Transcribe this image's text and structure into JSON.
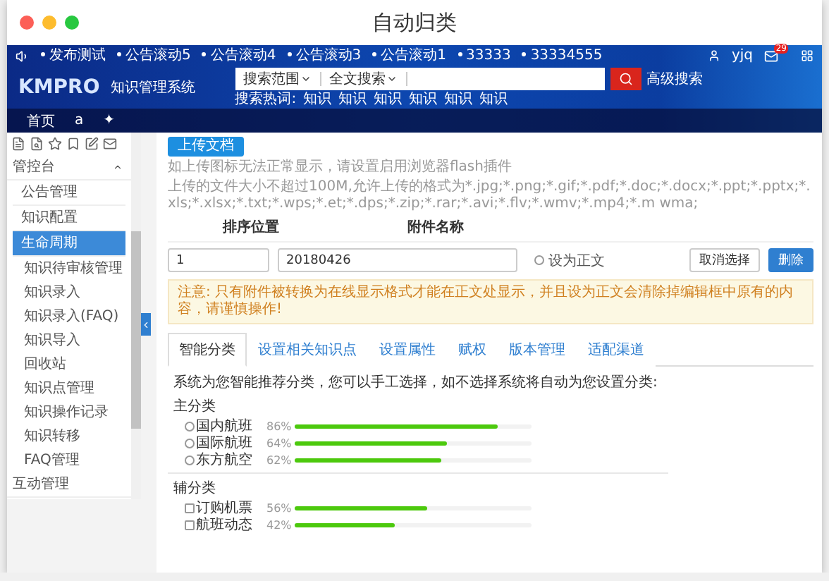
{
  "window": {
    "title": "自动归类"
  },
  "top_bar": {
    "notices": [
      "发布测试",
      "公告滚动5",
      "公告滚动4",
      "公告滚动3",
      "公告滚动1",
      "33333",
      "33334555"
    ],
    "user": "yjq",
    "mail_badge": "29"
  },
  "header": {
    "logo": "KMPRO",
    "system_name": "知识管理系统",
    "search": {
      "scope": "搜索范围",
      "mode": "全文搜索",
      "advanced": "高级搜索",
      "hot_label": "搜索热词:",
      "hot_words": [
        "知识",
        "知识",
        "知识",
        "知识",
        "知识",
        "知识"
      ]
    }
  },
  "nav": {
    "items": [
      "首页",
      "a",
      "✦"
    ]
  },
  "sidebar": {
    "items": [
      {
        "label": "管控台",
        "selected": false,
        "expanded": true,
        "children": [
          {
            "label": "公告管理",
            "selected": false
          },
          {
            "label": "知识配置",
            "selected": false
          },
          {
            "label": "生命周期",
            "selected": true,
            "children": [
              {
                "label": "知识待审核管理",
                "selected": false
              },
              {
                "label": "知识录入",
                "selected": false
              },
              {
                "label": "知识录入(FAQ)",
                "selected": false
              },
              {
                "label": "知识导入",
                "selected": false
              },
              {
                "label": "回收站",
                "selected": false
              },
              {
                "label": "知识点管理",
                "selected": false
              },
              {
                "label": "知识操作记录",
                "selected": false
              },
              {
                "label": "知识转移",
                "selected": false
              },
              {
                "label": "FAQ管理",
                "selected": false
              }
            ]
          }
        ]
      },
      {
        "label": "互动管理",
        "selected": false
      }
    ]
  },
  "upload": {
    "button": "上传文档",
    "hint": "如上传图标无法正常显示，请设置启用浏览器flash插件",
    "formats": "上传的文件大小不超过100M,允许上传的格式为*.jpg;*.png;*.gif;*.pdf;*.doc;*.docx;*.ppt;*.pptx;*.xls;*.xlsx;*.txt;*.wps;*.et;*.dps;*.zip;*.rar;*.avi;*.flv;*.wmv;*.mp4;*.m wma;"
  },
  "attachments": {
    "columns": [
      "排序位置",
      "附件名称"
    ],
    "rows": [
      {
        "order": "1",
        "name": "20180426",
        "main_text": {
          "label": "设为正文",
          "checked": false
        },
        "actions": [
          {
            "label": "取消选择",
            "kind": "default"
          },
          {
            "label": "删除",
            "kind": "primary"
          }
        ]
      }
    ]
  },
  "notice": "注意: 只有附件被转换为在线显示格式才能在正文处显示，并且设为正文会清除掉编辑框中原有的内容，请谨慎操作!",
  "tabs": [
    {
      "label": "智能分类",
      "selected": true
    },
    {
      "label": "设置相关知识点",
      "selected": false
    },
    {
      "label": "设置属性",
      "selected": false
    },
    {
      "label": "赋权",
      "selected": false
    },
    {
      "label": "版本管理",
      "selected": false
    },
    {
      "label": "适配渠道",
      "selected": false
    }
  ],
  "classification": {
    "intro": "系统为您智能推荐分类，您可以手工选择，如不选择系统将自动为您设置分类:",
    "groups": [
      {
        "title": "主分类",
        "kind": "radio",
        "items": [
          {
            "label": "国内航班",
            "percent": "86%",
            "level": 0.86,
            "checked": false
          },
          {
            "label": "国际航班",
            "percent": "64%",
            "level": 0.64,
            "checked": false
          },
          {
            "label": "东方航空",
            "percent": "62%",
            "level": 0.62,
            "checked": false
          }
        ]
      },
      {
        "title": "辅分类",
        "kind": "checkbox",
        "items": [
          {
            "label": "订购机票",
            "percent": "56%",
            "level": 0.56,
            "checked": false
          },
          {
            "label": "航班动态",
            "percent": "42%",
            "level": 0.42,
            "checked": false
          }
        ]
      }
    ]
  }
}
